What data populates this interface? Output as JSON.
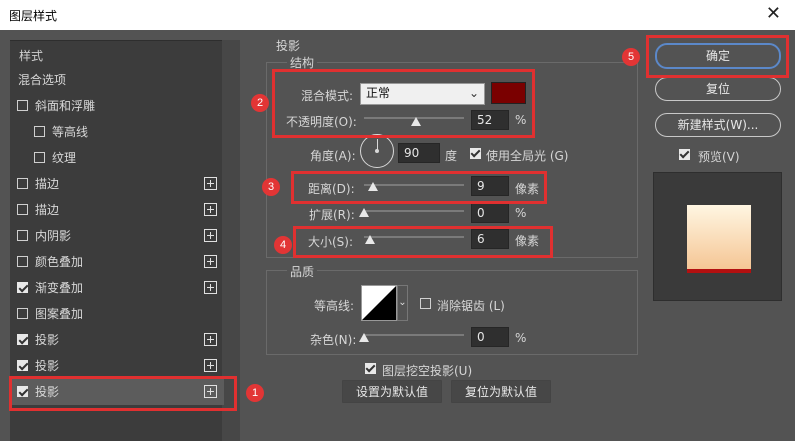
{
  "window": {
    "title": "图层样式",
    "close_glyph": "✕"
  },
  "left_panel": {
    "header": "样式",
    "items": [
      {
        "label": "混合选项",
        "checkbox": null,
        "plus": false
      },
      {
        "label": "斜面和浮雕",
        "checkbox": false,
        "plus": false
      },
      {
        "label": "等高线",
        "checkbox": false,
        "plus": false,
        "indent": true
      },
      {
        "label": "纹理",
        "checkbox": false,
        "plus": false,
        "indent": true
      },
      {
        "label": "描边",
        "checkbox": false,
        "plus": true
      },
      {
        "label": "描边",
        "checkbox": false,
        "plus": true
      },
      {
        "label": "内阴影",
        "checkbox": false,
        "plus": true
      },
      {
        "label": "颜色叠加",
        "checkbox": false,
        "plus": true
      },
      {
        "label": "渐变叠加",
        "checkbox": true,
        "plus": true
      },
      {
        "label": "图案叠加",
        "checkbox": false,
        "plus": false
      },
      {
        "label": "投影",
        "checkbox": true,
        "plus": true
      },
      {
        "label": "投影",
        "checkbox": true,
        "plus": true
      },
      {
        "label": "投影",
        "checkbox": true,
        "plus": true,
        "selected": true
      }
    ]
  },
  "drop_shadow": {
    "section_title": "投影",
    "structure": {
      "title": "结构",
      "blend_mode_label": "混合模式:",
      "blend_mode_value": "正常",
      "color": "#7a0000",
      "opacity_label": "不透明度(O):",
      "opacity_value": "52",
      "opacity_unit": "%",
      "opacity_fraction": 0.52,
      "angle_label": "角度(A):",
      "angle_value": "90",
      "angle_unit": "度",
      "global_light_label": "使用全局光 (G)",
      "global_light": true,
      "distance_label": "距离(D):",
      "distance_value": "9",
      "distance_unit": "像素",
      "distance_fraction": 0.09,
      "spread_label": "扩展(R):",
      "spread_value": "0",
      "spread_unit": "%",
      "spread_fraction": 0.0,
      "size_label": "大小(S):",
      "size_value": "6",
      "size_unit": "像素",
      "size_fraction": 0.06
    },
    "quality": {
      "title": "品质",
      "contour_label": "等高线:",
      "anti_alias_label": "消除锯齿 (L)",
      "anti_alias": false,
      "noise_label": "杂色(N):",
      "noise_value": "0",
      "noise_unit": "%",
      "noise_fraction": 0.0
    },
    "knockout_label": "图层挖空投影(U)",
    "knockout": true,
    "set_default_label": "设置为默认值",
    "reset_default_label": "复位为默认值"
  },
  "right_panel": {
    "ok_label": "确定",
    "reset_label": "复位",
    "new_style_label": "新建样式(W)...",
    "preview_label": "预览(V)",
    "preview": true
  },
  "annotations": [
    "1",
    "2",
    "3",
    "4",
    "5"
  ],
  "colors": {
    "annotation_red": "#e03030",
    "dialog_bg": "#535353",
    "panel_bg": "#3c3c3c"
  }
}
